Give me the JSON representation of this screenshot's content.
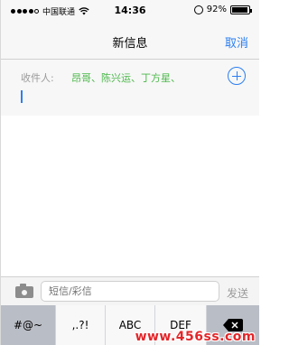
{
  "status_bar": {
    "carrier": "中国联通",
    "time": "14:36",
    "battery": "92%",
    "battery_level": 0.92,
    "signal_bars_filled": 4
  },
  "nav": {
    "title": "新信息",
    "cancel_label": "取消"
  },
  "recipients": {
    "label": "收件人:",
    "names": "昂哥、陈兴运、丁方星、"
  },
  "compose": {
    "placeholder": "短信/彩信",
    "send_label": "发送"
  },
  "keyboard": {
    "keys": [
      "#@~",
      ",.?!",
      "ABC",
      "DEF"
    ]
  },
  "watermark": "www.456ss.com",
  "colors": {
    "accent": "#2b7ff1",
    "recipient_green": "#4cb84b"
  }
}
